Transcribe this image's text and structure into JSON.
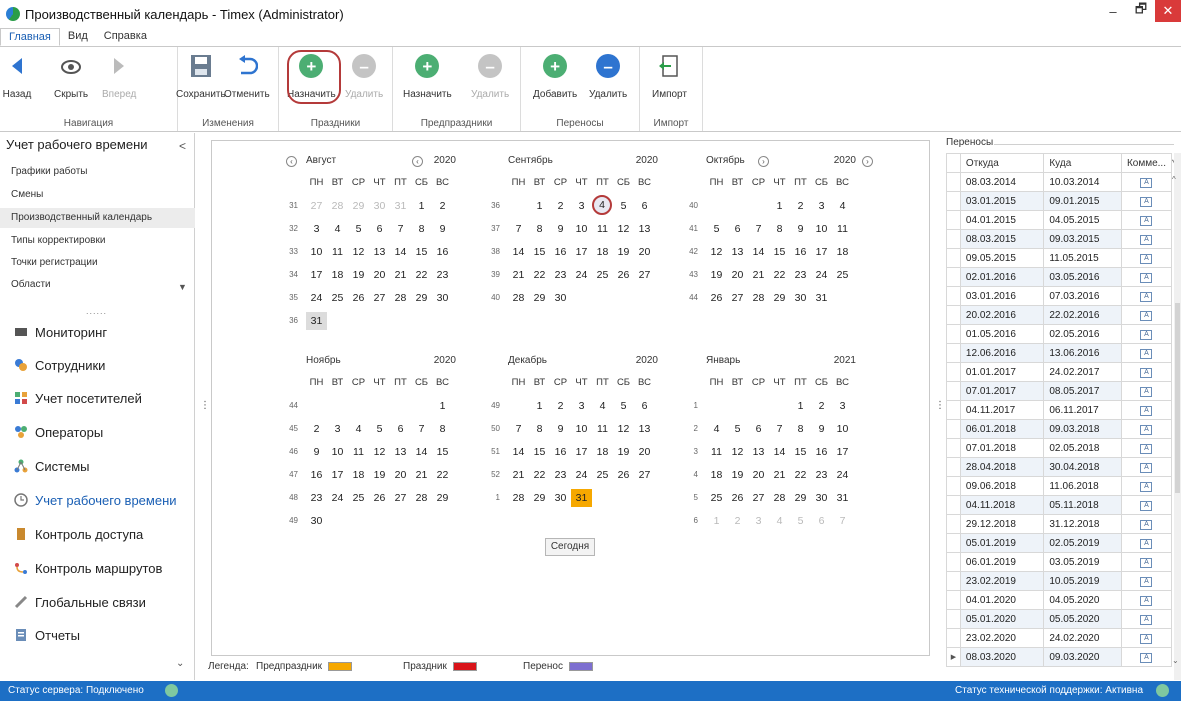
{
  "window": {
    "title": "Производственный календарь - Timex (Administrator)",
    "minimize": "–",
    "restore": "🗗",
    "close": "✕"
  },
  "menu": {
    "tabs": [
      "Главная",
      "Вид",
      "Справка"
    ]
  },
  "ribbon": {
    "groups": [
      {
        "title": "Навигация",
        "buttons": [
          "Назад",
          "Скрыть",
          "Вперед"
        ]
      },
      {
        "title": "Изменения",
        "buttons": [
          "Сохранить",
          "Отменить"
        ]
      },
      {
        "title": "Праздники",
        "buttons": [
          "Назначить",
          "Удалить"
        ]
      },
      {
        "title": "Предпраздники",
        "buttons": [
          "Назначить",
          "Удалить"
        ]
      },
      {
        "title": "Переносы",
        "buttons": [
          "Добавить",
          "Удалить"
        ]
      },
      {
        "title": "Импорт",
        "buttons": [
          "Импорт"
        ]
      }
    ]
  },
  "sidebar": {
    "header": "Учет рабочего времени",
    "subitems": [
      "Графики работы",
      "Смены",
      "Производственный календарь",
      "Типы корректировки",
      "Точки регистрации",
      "Области"
    ],
    "selected_subitem": "Производственный календарь",
    "main_items": [
      "Мониторинг",
      "Сотрудники",
      "Учет посетителей",
      "Операторы",
      "Системы",
      "Учет рабочего времени",
      "Контроль доступа",
      "Контроль маршрутов",
      "Глобальные связи",
      "Отчеты"
    ],
    "active_main": "Учет рабочего времени"
  },
  "calendar": {
    "dow": [
      "ПН",
      "ВТ",
      "СР",
      "ЧТ",
      "ПТ",
      "СБ",
      "ВС"
    ],
    "today_button": "Сегодня",
    "months": [
      {
        "name": "Август",
        "year": "2020",
        "weeks": [
          "31",
          "32",
          "33",
          "34",
          "35",
          "36"
        ],
        "days": [
          "27",
          "28",
          "29",
          "30",
          "31",
          "1",
          "2",
          "3",
          "4",
          "5",
          "6",
          "7",
          "8",
          "9",
          "10",
          "11",
          "12",
          "13",
          "14",
          "15",
          "16",
          "17",
          "18",
          "19",
          "20",
          "21",
          "22",
          "23",
          "24",
          "25",
          "26",
          "27",
          "28",
          "29",
          "30",
          "31"
        ]
      },
      {
        "name": "Сентябрь",
        "year": "2020",
        "weeks": [
          "36",
          "37",
          "38",
          "39",
          "40"
        ],
        "days": [
          "1",
          "2",
          "3",
          "4",
          "5",
          "6",
          "7",
          "8",
          "9",
          "10",
          "11",
          "12",
          "13",
          "14",
          "15",
          "16",
          "17",
          "18",
          "19",
          "20",
          "21",
          "22",
          "23",
          "24",
          "25",
          "26",
          "27",
          "28",
          "29",
          "30"
        ]
      },
      {
        "name": "Октябрь",
        "year": "2020",
        "weeks": [
          "40",
          "41",
          "42",
          "43",
          "44"
        ],
        "days": [
          "1",
          "2",
          "3",
          "4",
          "5",
          "6",
          "7",
          "8",
          "9",
          "10",
          "11",
          "12",
          "13",
          "14",
          "15",
          "16",
          "17",
          "18",
          "19",
          "20",
          "21",
          "22",
          "23",
          "24",
          "25",
          "26",
          "27",
          "28",
          "29",
          "30",
          "31"
        ]
      },
      {
        "name": "Ноябрь",
        "year": "2020",
        "weeks": [
          "44",
          "45",
          "46",
          "47",
          "48",
          "49"
        ],
        "days": [
          "1",
          "2",
          "3",
          "4",
          "5",
          "6",
          "7",
          "8",
          "9",
          "10",
          "11",
          "12",
          "13",
          "14",
          "15",
          "16",
          "17",
          "18",
          "19",
          "20",
          "21",
          "22",
          "23",
          "24",
          "25",
          "26",
          "27",
          "28",
          "29",
          "30"
        ]
      },
      {
        "name": "Декабрь",
        "year": "2020",
        "weeks": [
          "49",
          "50",
          "51",
          "52",
          "1"
        ],
        "days": [
          "1",
          "2",
          "3",
          "4",
          "5",
          "6",
          "7",
          "8",
          "9",
          "10",
          "11",
          "12",
          "13",
          "14",
          "15",
          "16",
          "17",
          "18",
          "19",
          "20",
          "21",
          "22",
          "23",
          "24",
          "25",
          "26",
          "27",
          "28",
          "29",
          "30",
          "31"
        ]
      },
      {
        "name": "Январь",
        "year": "2021",
        "weeks": [
          "1",
          "2",
          "3",
          "4",
          "5",
          "6"
        ],
        "days": [
          "1",
          "2",
          "3",
          "4",
          "5",
          "6",
          "7",
          "8",
          "9",
          "10",
          "11",
          "12",
          "13",
          "14",
          "15",
          "16",
          "17",
          "18",
          "19",
          "20",
          "21",
          "22",
          "23",
          "24",
          "25",
          "26",
          "27",
          "28",
          "29",
          "30",
          "31",
          "1",
          "2",
          "3",
          "4",
          "5",
          "6",
          "7"
        ]
      }
    ]
  },
  "legend": {
    "label": "Легенда:",
    "items": [
      {
        "name": "Предпраздник",
        "color": "#f6a800"
      },
      {
        "name": "Праздник",
        "color": "#d9141a"
      },
      {
        "name": "Перенос",
        "color": "#7d6fd0"
      }
    ]
  },
  "transfers": {
    "title": "Переносы",
    "columns": [
      "Откуда",
      "Куда",
      "Комме..."
    ],
    "rows": [
      [
        "08.03.2014",
        "10.03.2014"
      ],
      [
        "03.01.2015",
        "09.01.2015"
      ],
      [
        "04.01.2015",
        "04.05.2015"
      ],
      [
        "08.03.2015",
        "09.03.2015"
      ],
      [
        "09.05.2015",
        "11.05.2015"
      ],
      [
        "02.01.2016",
        "03.05.2016"
      ],
      [
        "03.01.2016",
        "07.03.2016"
      ],
      [
        "20.02.2016",
        "22.02.2016"
      ],
      [
        "01.05.2016",
        "02.05.2016"
      ],
      [
        "12.06.2016",
        "13.06.2016"
      ],
      [
        "01.01.2017",
        "24.02.2017"
      ],
      [
        "07.01.2017",
        "08.05.2017"
      ],
      [
        "04.11.2017",
        "06.11.2017"
      ],
      [
        "06.01.2018",
        "09.03.2018"
      ],
      [
        "07.01.2018",
        "02.05.2018"
      ],
      [
        "28.04.2018",
        "30.04.2018"
      ],
      [
        "09.06.2018",
        "11.06.2018"
      ],
      [
        "04.11.2018",
        "05.11.2018"
      ],
      [
        "29.12.2018",
        "31.12.2018"
      ],
      [
        "05.01.2019",
        "02.05.2019"
      ],
      [
        "06.01.2019",
        "03.05.2019"
      ],
      [
        "23.02.2019",
        "10.05.2019"
      ],
      [
        "04.01.2020",
        "04.05.2020"
      ],
      [
        "05.01.2020",
        "05.05.2020"
      ],
      [
        "23.02.2020",
        "24.02.2020"
      ],
      [
        "08.03.2020",
        "09.03.2020"
      ]
    ]
  },
  "status": {
    "left": "Статус сервера: Подключено",
    "right": "Статус технической поддержки: Активна"
  }
}
